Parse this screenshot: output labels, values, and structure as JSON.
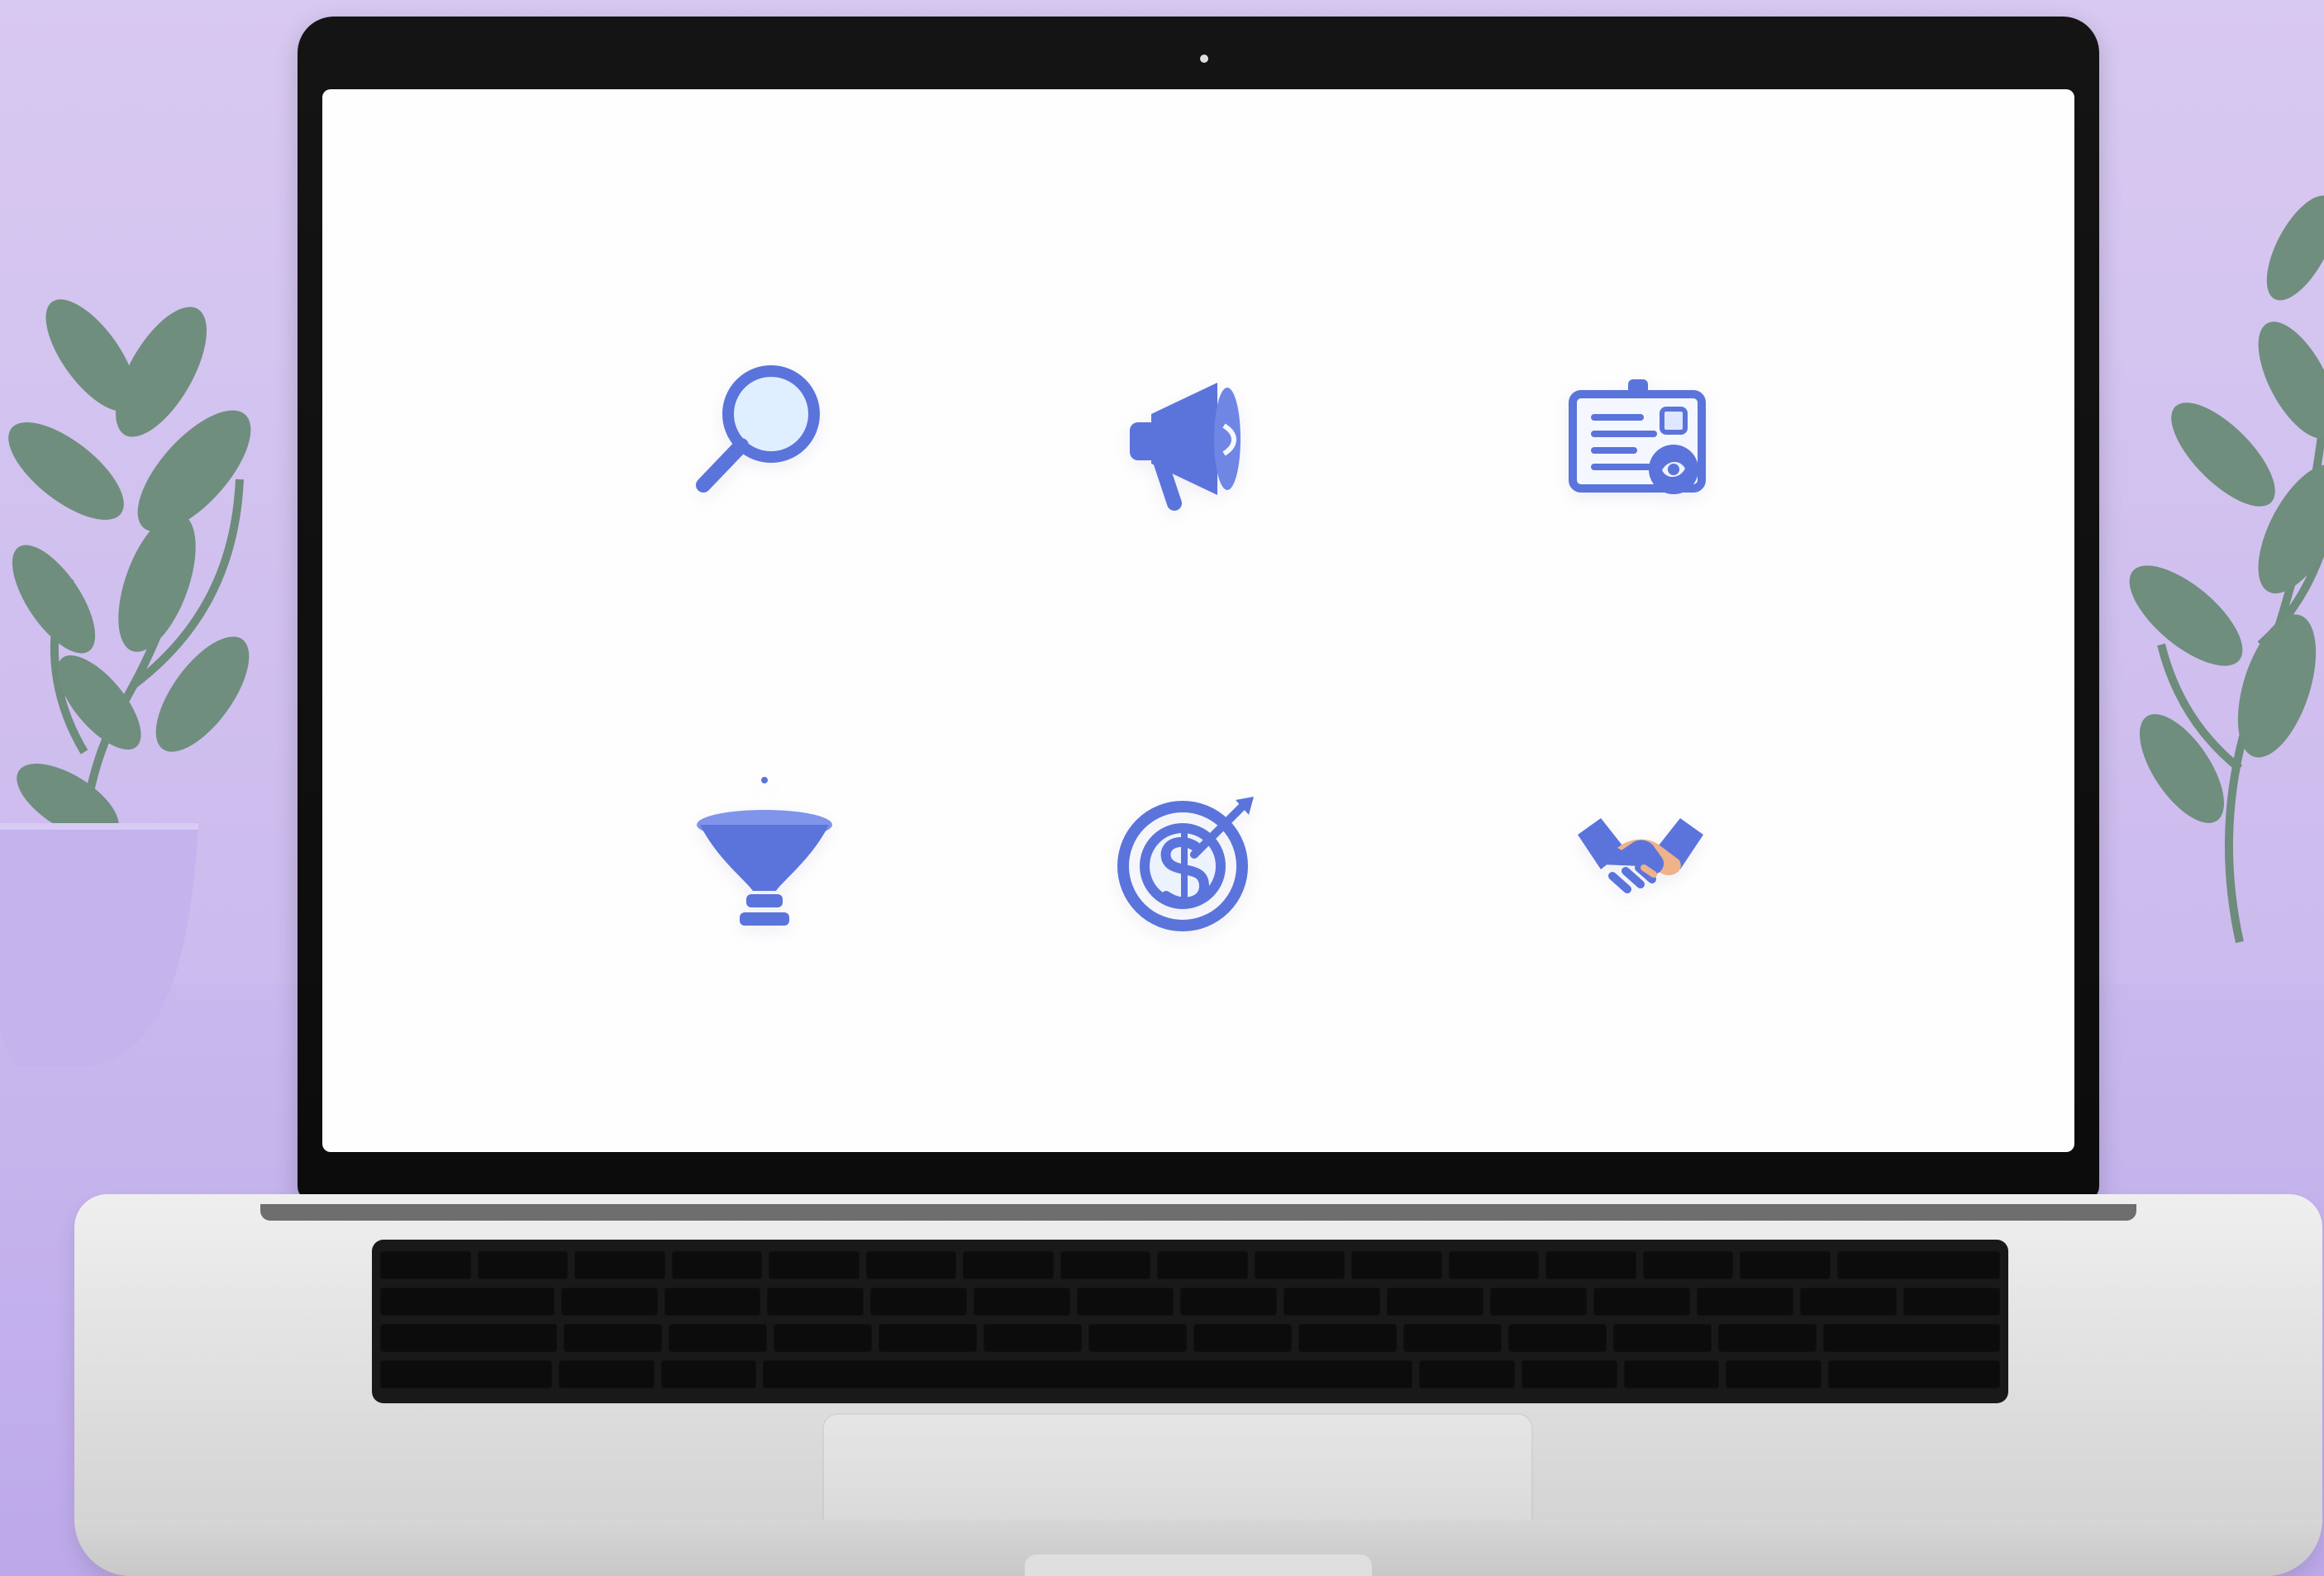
{
  "scene": {
    "colors": {
      "background": "#d6c8f0",
      "icon_blue": "#5b74db",
      "icon_light_blue": "#dfefff",
      "handshake_peach": "#f0b28a",
      "laptop_dark": "#111111",
      "laptop_silver": "#dcdcdc"
    },
    "icons": [
      "search-icon",
      "megaphone-icon",
      "contact-card-icon",
      "funnel-icon",
      "dollar-target-icon",
      "handshake-icon"
    ]
  }
}
